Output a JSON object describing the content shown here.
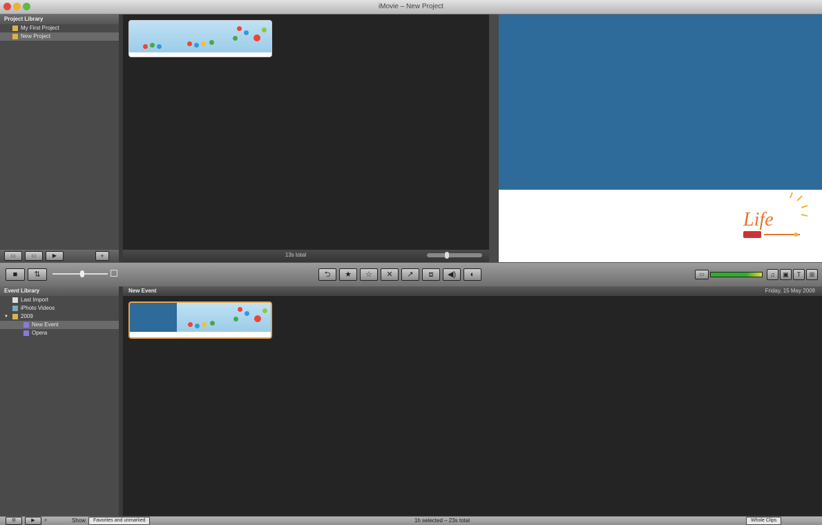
{
  "window": {
    "title": "iMovie – New Project"
  },
  "project_library": {
    "header": "Project Library",
    "items": [
      {
        "label": "My First Project",
        "selected": false
      },
      {
        "label": "New Project",
        "selected": true
      }
    ]
  },
  "project_browser": {
    "status": "13s total"
  },
  "toolbar": {
    "tools": [
      {
        "glyph": "⮌",
        "name": "undo-icon"
      },
      {
        "glyph": "★",
        "name": "favorite-icon"
      },
      {
        "glyph": "☆",
        "name": "unmark-icon"
      },
      {
        "glyph": "✕",
        "name": "reject-icon"
      },
      {
        "glyph": "↗",
        "name": "adjust-icon"
      },
      {
        "glyph": "⧈",
        "name": "crop-icon"
      },
      {
        "glyph": "◀)",
        "name": "audio-icon"
      },
      {
        "glyph": "◐",
        "name": "inspector-icon"
      }
    ],
    "right_buttons": [
      {
        "glyph": "♫",
        "name": "music-browser-icon"
      },
      {
        "glyph": "▣",
        "name": "photo-browser-icon"
      },
      {
        "glyph": "T",
        "name": "title-browser-icon"
      },
      {
        "glyph": "⊞",
        "name": "transition-browser-icon"
      }
    ]
  },
  "event_library": {
    "header": "Event Library",
    "items": [
      {
        "label": "Last Import",
        "indent": 0,
        "selected": false
      },
      {
        "label": "iPhoto Videos",
        "indent": 0,
        "selected": false
      },
      {
        "label": "2009",
        "indent": 0,
        "selected": false
      },
      {
        "label": "New Event",
        "indent": 1,
        "selected": true
      },
      {
        "label": "Opera",
        "indent": 1,
        "selected": false
      }
    ]
  },
  "event_browser": {
    "title": "New Event",
    "date": "Friday, 15 May 2009"
  },
  "status_bar": {
    "show_label": "Show",
    "show_value": "Favorites and unmarked",
    "summary": "1h selected – 23s total",
    "right_label": "Whole Clips"
  },
  "colors": {
    "accent": "#2e6b9a",
    "clip_border": "#e8a74a",
    "dark_bg": "#242424"
  }
}
